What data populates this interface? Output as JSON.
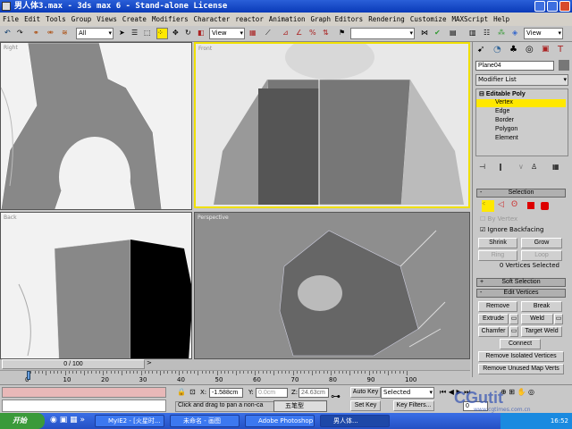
{
  "window": {
    "title": "男人体3.max - 3ds max 6 - Stand-alone License"
  },
  "menu": [
    "File",
    "Edit",
    "Tools",
    "Group",
    "Views",
    "Create",
    "Modifiers",
    "Character",
    "reactor",
    "Animation",
    "Graph Editors",
    "Rendering",
    "Customize",
    "MAXScript",
    "Help"
  ],
  "toolbar": {
    "selection_filter": "All",
    "ref_coord": "View",
    "named_selection": "",
    "ref_coord2": "View"
  },
  "viewports": [
    {
      "label": "Right"
    },
    {
      "label": "Front",
      "active": true
    },
    {
      "label": "Back"
    },
    {
      "label": "Perspective"
    }
  ],
  "command_panel": {
    "object_name": "Plane04",
    "modifier_list": "Modifier List",
    "stack": {
      "root": "Editable Poly",
      "items": [
        "Vertex",
        "Edge",
        "Border",
        "Polygon",
        "Element"
      ],
      "selected": "Vertex"
    },
    "selection": {
      "title": "Selection",
      "by_vertex": "By Vertex",
      "by_vertex_checked": false,
      "ignore_backfacing": "Ignore Backfacing",
      "ignore_backfacing_checked": true,
      "shrink": "Shrink",
      "grow": "Grow",
      "ring": "Ring",
      "loop": "Loop",
      "status": "0 Vertices Selected"
    },
    "soft_selection": {
      "title": "Soft Selection"
    },
    "edit_vertices": {
      "title": "Edit Vertices",
      "remove": "Remove",
      "break": "Break",
      "extrude": "Extrude",
      "weld": "Weld",
      "chamfer": "Chamfer",
      "target_weld": "Target Weld",
      "connect": "Connect",
      "remove_isolated": "Remove Isolated Vertices",
      "remove_unused": "Remove Unused Map Verts"
    }
  },
  "timeline": {
    "frame": "0 / 100",
    "ticks": [
      "0",
      "10",
      "20",
      "30",
      "40",
      "50",
      "60",
      "70",
      "80",
      "90",
      "100"
    ]
  },
  "status": {
    "x": "-1.588cm",
    "y": "0.0cm",
    "z": "24.63cm",
    "x_label": "X:",
    "y_label": "Y:",
    "z_label": "Z:",
    "prompt": "Click and drag to pan a non-ca",
    "ime": "五笔型",
    "auto_key": "Auto Key",
    "selected": "Selected",
    "set_key": "Set Key",
    "key_filters": "Key Filters...",
    "frame_field": "0"
  },
  "watermark": {
    "text": "CGutit",
    "url": "www.cgtimes.com.cn"
  },
  "taskbar": {
    "start": "开始",
    "tasks": [
      "MyIE2 - [火星时...",
      "未命名 - 画图",
      "Adobe Photoshop",
      "男人体..."
    ],
    "active_task": 3,
    "clock": "16:52"
  },
  "colors": {
    "title_bar": "#0a3ab8",
    "active_viewport_border": "#f0e000",
    "stack_selected": "#ffe800",
    "viewport_bg": "#9a9a9a"
  }
}
